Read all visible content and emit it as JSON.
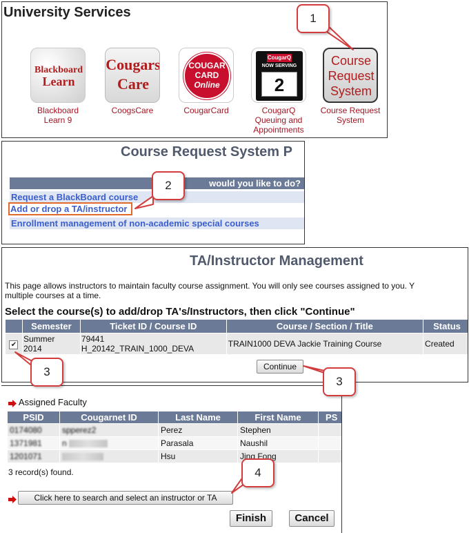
{
  "panel1": {
    "title": "University Services",
    "services": [
      {
        "caption": "Blackboard Learn 9",
        "tile_text": [
          "Blackboard",
          "Learn"
        ]
      },
      {
        "caption": "CoogsCare",
        "tile_text": [
          "Cougars",
          "Care"
        ]
      },
      {
        "caption": "CougarCard",
        "tile_text": [
          "COUGAR",
          "CARD",
          "Online"
        ]
      },
      {
        "caption": "CougarQ Queuing and Appointments",
        "tile_text": [
          "CougarQ",
          "NOW SERVING",
          "2"
        ]
      },
      {
        "caption": "Course Request System",
        "tile_text": [
          "Course",
          "Request",
          "System"
        ]
      }
    ]
  },
  "panel2": {
    "heading": "Course Request System P",
    "question": "would you like to do?",
    "links": [
      "Request a BlackBoard course",
      "Add or drop a TA/instructor",
      "Enrollment management of non-academic special courses"
    ]
  },
  "panel3": {
    "heading": "TA/Instructor Management",
    "desc_line1": "This page allows instructors to maintain faculty course assignment. You will only see courses assigned to you. Y",
    "desc_line2": "multiple courses at a time.",
    "instruction": "Select the course(s) to add/drop TA's/Instructors, then click \"Continue\"",
    "columns": [
      "Semester",
      "Ticket ID / Course ID",
      "Course / Section / Title",
      "Status"
    ],
    "row": {
      "checkbox": "✔",
      "semester_1": "Summer",
      "semester_2": "2014",
      "ticket_1": "79441",
      "ticket_2": "H_20142_TRAIN_1000_DEVA",
      "course": "TRAIN1000 DEVA Jackie Training Course",
      "status": "Created"
    },
    "continue_label": "Continue"
  },
  "panel4": {
    "section_title": "Assigned Faculty",
    "columns": [
      "PSID",
      "Cougarnet ID",
      "Last Name",
      "First Name",
      "PS"
    ],
    "rows": [
      {
        "psid": "0174080",
        "cougarnet": "spperez2",
        "last": "Perez",
        "first": "Stephen"
      },
      {
        "psid": "1371981",
        "cougarnet": "n",
        "last": "Parasala",
        "first": "Naushil"
      },
      {
        "psid": "1201071",
        "cougarnet": "",
        "last": "Hsu",
        "first": "Jing Fong"
      }
    ],
    "record_count": "3 record(s) found.",
    "search_label": "Click here to search and select an instructor or TA",
    "finish_label": "Finish",
    "cancel_label": "Cancel"
  },
  "callouts": [
    "1",
    "2",
    "3",
    "3",
    "4"
  ],
  "colors": {
    "accent_red": "#d23c3c",
    "header_gray": "#6b7a96",
    "link_blue": "#3a5fcd",
    "caption_red": "#a21624"
  }
}
